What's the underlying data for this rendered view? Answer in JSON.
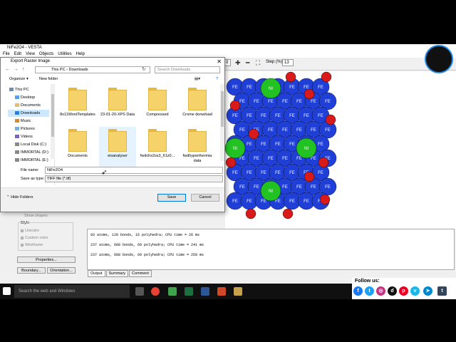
{
  "vesta": {
    "title": "NiFe2O4 - VESTA",
    "menu": [
      "File",
      "Edit",
      "View",
      "Objects",
      "Utilities",
      "Help"
    ],
    "zoom_value": "0",
    "step_label": "Step (%):",
    "step_value": "13"
  },
  "dialog": {
    "title": "Export Raster Image",
    "breadcrumb": [
      "This PC",
      "Downloads"
    ],
    "search_placeholder": "Search Downloads",
    "organize_label": "Organize",
    "new_folder_label": "New folder",
    "tree": [
      {
        "label": "This PC",
        "icon": "pc-icon"
      },
      {
        "label": "Desktop",
        "icon": "desktop-icon"
      },
      {
        "label": "Documents",
        "icon": "documents-icon"
      },
      {
        "label": "Downloads",
        "icon": "downloads-icon",
        "selected": true
      },
      {
        "label": "Music",
        "icon": "music-icon"
      },
      {
        "label": "Pictures",
        "icon": "pictures-icon"
      },
      {
        "label": "Videos",
        "icon": "videos-icon"
      },
      {
        "label": "Local Disk (C:)",
        "icon": "disk-icon"
      },
      {
        "label": "IMMORTAL (D:)",
        "icon": "disk-icon"
      },
      {
        "label": "IMMORTAL (E:)",
        "icon": "disk-icon"
      }
    ],
    "files": [
      {
        "name": "8x11WordTemplates"
      },
      {
        "name": "23-01-20-XPS Data"
      },
      {
        "name": "Compressed"
      },
      {
        "name": "Crome donwload"
      },
      {
        "name": "Documents"
      },
      {
        "name": "eisanalyser",
        "selected": true
      },
      {
        "name": "fwdchs2ss3_61z0..."
      },
      {
        "name": "fwdhyperthermia data"
      }
    ],
    "file_name_label": "File name:",
    "file_name_value": "NiFe2O4",
    "save_type_label": "Save as type:",
    "save_type_value": "TIFF file (*.tif)",
    "hide_folders_label": "Hide Folders",
    "save_label": "Save",
    "cancel_label": "Cancel"
  },
  "left_panel": {
    "show_shapes": "Show shapes",
    "style_label": "Style",
    "options": [
      "Unicolor",
      "Custom color",
      "Wireframe"
    ],
    "properties_label": "Properties...",
    "boundary_label": "Boundary...",
    "orientation_label": "Orientation..."
  },
  "output": {
    "lines": [
      "93 atoms, 128 bonds, 16 polyhedra; CPU time = 26 ms",
      "237 atoms, 688 bonds, 69 polyhedra; CPU time = 241 ms",
      "237 atoms, 688 bonds, 69 polyhedra; CPU time = 259 ms"
    ],
    "tabs": [
      "Output",
      "Summary",
      "Comment"
    ]
  },
  "crystal": {
    "fe_label": "FE",
    "ni_label": "NI",
    "colors": {
      "fe": "#1f3fd6",
      "ni": "#22c222",
      "o": "#d81a1a"
    }
  },
  "taskbar": {
    "search_placeholder": "Search the web and Windows"
  },
  "follow": {
    "title": "Follow us:",
    "icons": [
      "facebook-icon",
      "twitter-icon",
      "instagram-icon",
      "dailymotion-icon",
      "pinterest-icon",
      "vimeo-icon",
      "telegram-icon",
      "tumblr-icon"
    ]
  }
}
